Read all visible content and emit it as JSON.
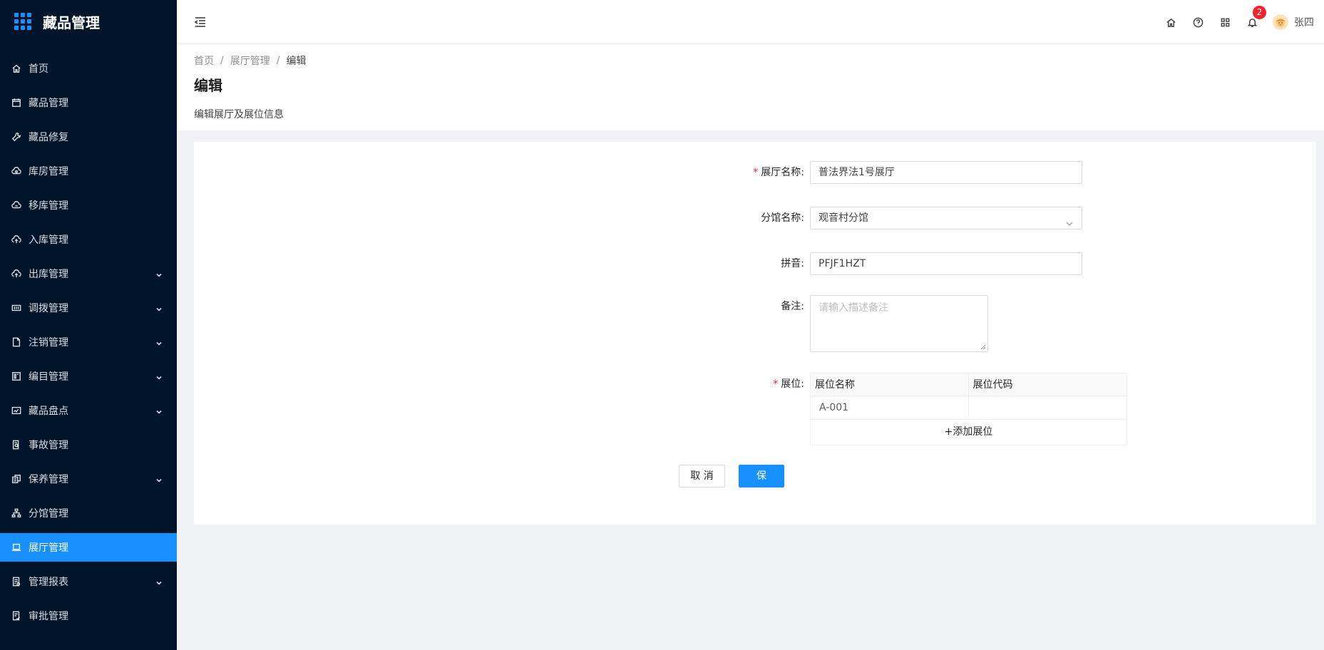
{
  "app": {
    "title": "藏品管理"
  },
  "sidebar": {
    "items": [
      {
        "label": "首页",
        "icon": "home-icon",
        "expandable": false,
        "active": false
      },
      {
        "label": "藏品管理",
        "icon": "calendar-icon",
        "expandable": false,
        "active": false
      },
      {
        "label": "藏品修复",
        "icon": "tool-icon",
        "expandable": false,
        "active": false
      },
      {
        "label": "库房管理",
        "icon": "cloud-icon",
        "expandable": false,
        "active": false
      },
      {
        "label": "移库管理",
        "icon": "cloud-sync-icon",
        "expandable": false,
        "active": false
      },
      {
        "label": "入库管理",
        "icon": "cloud-upload-icon",
        "expandable": false,
        "active": false
      },
      {
        "label": "出库管理",
        "icon": "cloud-upload-icon",
        "expandable": true,
        "active": false
      },
      {
        "label": "调拨管理",
        "icon": "transfer-icon",
        "expandable": true,
        "active": false
      },
      {
        "label": "注销管理",
        "icon": "file-icon",
        "expandable": true,
        "active": false
      },
      {
        "label": "编目管理",
        "icon": "catalog-icon",
        "expandable": true,
        "active": false
      },
      {
        "label": "藏品盘点",
        "icon": "inventory-icon",
        "expandable": true,
        "active": false
      },
      {
        "label": "事故管理",
        "icon": "file-search-icon",
        "expandable": false,
        "active": false
      },
      {
        "label": "保养管理",
        "icon": "maintenance-icon",
        "expandable": true,
        "active": false
      },
      {
        "label": "分馆管理",
        "icon": "cluster-icon",
        "expandable": false,
        "active": false
      },
      {
        "label": "展厅管理",
        "icon": "laptop-icon",
        "expandable": false,
        "active": true
      },
      {
        "label": "管理报表",
        "icon": "report-icon",
        "expandable": true,
        "active": false
      },
      {
        "label": "审批管理",
        "icon": "audit-icon",
        "expandable": false,
        "active": false
      }
    ]
  },
  "header": {
    "notification_count": "2",
    "user_name": "张四"
  },
  "breadcrumb": [
    "首页",
    "展厅管理",
    "编辑"
  ],
  "page": {
    "title": "编辑",
    "description": "编辑展厅及展位信息"
  },
  "form": {
    "hall_name": {
      "label": "展厅名称:",
      "value": "普法界法1号展厅",
      "required": true
    },
    "branch_name": {
      "label": "分馆名称:",
      "value": "观音村分馆"
    },
    "pinyin": {
      "label": "拼音:",
      "value": "PFJF1HZT"
    },
    "remark": {
      "label": "备注:",
      "placeholder": "请输入描述备注"
    },
    "booth": {
      "label": "展位:",
      "required": true,
      "columns": [
        "展位名称",
        "展位代码"
      ],
      "rows": [
        [
          "A-001",
          ""
        ]
      ],
      "add_label": "+添加展位"
    },
    "cancel_label": "取 消",
    "save_label": "保 存"
  },
  "colors": {
    "sidebar_bg": "#001529",
    "accent": "#1890ff",
    "required": "#f5222d"
  }
}
